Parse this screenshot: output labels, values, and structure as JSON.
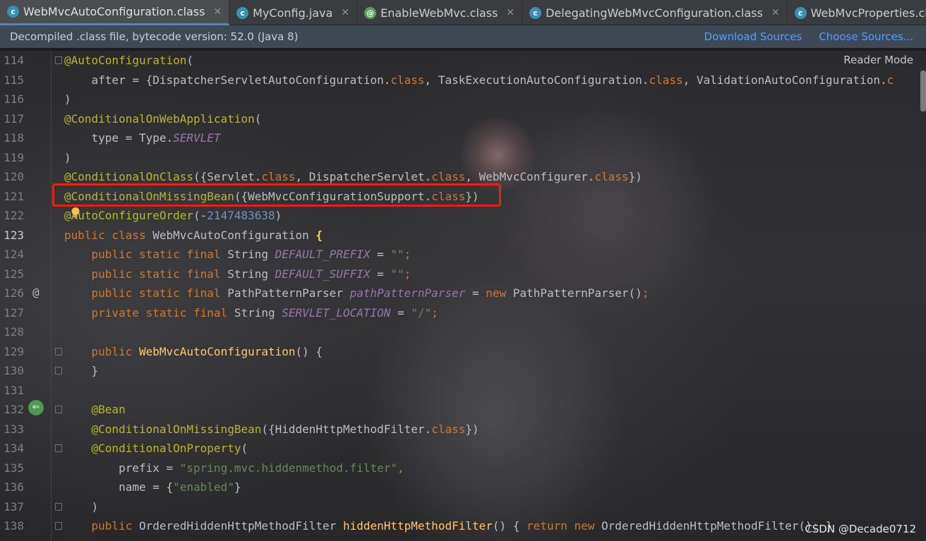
{
  "tabs": [
    {
      "label": "WebMvcAutoConfiguration.class",
      "icon": "class-file-icon",
      "active": true
    },
    {
      "label": "MyConfig.java",
      "icon": "class-file-icon",
      "active": false
    },
    {
      "label": "EnableWebMvc.class",
      "icon": "annotation-file-icon",
      "active": false
    },
    {
      "label": "DelegatingWebMvcConfiguration.class",
      "icon": "class-file-icon",
      "active": false
    },
    {
      "label": "WebMvcProperties.class",
      "icon": "class-file-icon",
      "active": false
    }
  ],
  "banner": {
    "message": "Decompiled .class file, bytecode version: 52.0 (Java 8)",
    "download_sources": "Download Sources",
    "choose_sources": "Choose Sources..."
  },
  "reader_mode": "Reader Mode",
  "current_line": 123,
  "lines": [
    {
      "n": "114",
      "fold": true,
      "tokens": [
        [
          "an",
          "@AutoConfiguration"
        ],
        [
          "p",
          "("
        ]
      ]
    },
    {
      "n": "115",
      "tokens": [
        [
          "p",
          "    after = {DispatcherServletAutoConfiguration."
        ],
        [
          "k",
          "class"
        ],
        [
          "p",
          ", "
        ],
        [
          "p",
          "TaskExecutionAutoConfiguration."
        ],
        [
          "k",
          "class"
        ],
        [
          "p",
          ", "
        ],
        [
          "p",
          "ValidationAutoConfiguration."
        ],
        [
          "k",
          "c"
        ]
      ]
    },
    {
      "n": "116",
      "tokens": [
        [
          "p",
          ")"
        ]
      ]
    },
    {
      "n": "117",
      "tokens": [
        [
          "an",
          "@ConditionalOnWebApplication"
        ],
        [
          "p",
          "("
        ]
      ]
    },
    {
      "n": "118",
      "tokens": [
        [
          "p",
          "    type = Type."
        ],
        [
          "sf",
          "SERVLET"
        ]
      ]
    },
    {
      "n": "119",
      "tokens": [
        [
          "p",
          ")"
        ]
      ]
    },
    {
      "n": "120",
      "tokens": [
        [
          "an",
          "@ConditionalOnClass"
        ],
        [
          "p",
          "({Servlet."
        ],
        [
          "k",
          "class"
        ],
        [
          "p",
          ", DispatcherServlet."
        ],
        [
          "k",
          "class"
        ],
        [
          "p",
          ", WebMvcConfigurer."
        ],
        [
          "k",
          "class"
        ],
        [
          "p",
          "})"
        ]
      ]
    },
    {
      "n": "121",
      "tokens": [
        [
          "an",
          "@ConditionalOnMissingBean"
        ],
        [
          "p",
          "({WebMvcConfigurationSupport."
        ],
        [
          "k",
          "class"
        ],
        [
          "p",
          "})"
        ]
      ]
    },
    {
      "n": "122",
      "tokens": [
        [
          "an",
          "@AutoConfigureOrder"
        ],
        [
          "p",
          "(-"
        ],
        [
          "nu",
          "2147483638"
        ],
        [
          "p",
          ")"
        ]
      ]
    },
    {
      "n": "123",
      "tokens": [
        [
          "k",
          "public class "
        ],
        [
          "p",
          "WebMvcAutoConfiguration "
        ],
        [
          "br",
          "{"
        ]
      ]
    },
    {
      "n": "124",
      "tokens": [
        [
          "k",
          "    public static final "
        ],
        [
          "p",
          "String "
        ],
        [
          "sf",
          "DEFAULT_PREFIX"
        ],
        [
          "p",
          " = "
        ],
        [
          "st",
          "\"\""
        ],
        [
          "k",
          ";"
        ]
      ]
    },
    {
      "n": "125",
      "tokens": [
        [
          "k",
          "    public static final "
        ],
        [
          "p",
          "String "
        ],
        [
          "sf",
          "DEFAULT_SUFFIX"
        ],
        [
          "p",
          " = "
        ],
        [
          "st",
          "\"\""
        ],
        [
          "k",
          ";"
        ]
      ]
    },
    {
      "n": "126",
      "mark": "@",
      "tokens": [
        [
          "k",
          "    public static final "
        ],
        [
          "p",
          "PathPatternParser "
        ],
        [
          "sf",
          "pathPatternParser"
        ],
        [
          "p",
          " = "
        ],
        [
          "k",
          "new "
        ],
        [
          "p",
          "PathPatternParser()"
        ],
        [
          "k",
          ";"
        ]
      ]
    },
    {
      "n": "127",
      "tokens": [
        [
          "k",
          "    private static final "
        ],
        [
          "p",
          "String "
        ],
        [
          "sf",
          "SERVLET_LOCATION"
        ],
        [
          "p",
          " = "
        ],
        [
          "st",
          "\"/\""
        ],
        [
          "k",
          ";"
        ]
      ]
    },
    {
      "n": "128",
      "tokens": []
    },
    {
      "n": "129",
      "fold": true,
      "tokens": [
        [
          "k",
          "    public "
        ],
        [
          "fn",
          "WebMvcAutoConfiguration"
        ],
        [
          "p",
          "() {"
        ]
      ]
    },
    {
      "n": "130",
      "fold": true,
      "tokens": [
        [
          "p",
          "    }"
        ]
      ]
    },
    {
      "n": "131",
      "tokens": []
    },
    {
      "n": "132",
      "run": true,
      "fold": true,
      "tokens": [
        [
          "an",
          "    @Bean"
        ]
      ]
    },
    {
      "n": "133",
      "tokens": [
        [
          "an",
          "    @ConditionalOnMissingBean"
        ],
        [
          "p",
          "({HiddenHttpMethodFilter."
        ],
        [
          "k",
          "class"
        ],
        [
          "p",
          "})"
        ]
      ]
    },
    {
      "n": "134",
      "fold": true,
      "tokens": [
        [
          "an",
          "    @ConditionalOnProperty"
        ],
        [
          "p",
          "("
        ]
      ]
    },
    {
      "n": "135",
      "tokens": [
        [
          "p",
          "        prefix = "
        ],
        [
          "st",
          "\"spring.mvc.hiddenmethod.filter\""
        ],
        [
          "k",
          ","
        ]
      ]
    },
    {
      "n": "136",
      "tokens": [
        [
          "p",
          "        name = {"
        ],
        [
          "st",
          "\"enabled\""
        ],
        [
          "p",
          "}"
        ]
      ]
    },
    {
      "n": "137",
      "fold": true,
      "tokens": [
        [
          "p",
          "    )"
        ]
      ]
    },
    {
      "n": "138",
      "fold": true,
      "tokens": [
        [
          "k",
          "    public "
        ],
        [
          "p",
          "OrderedHiddenHttpMethodFilter "
        ],
        [
          "fn",
          "hiddenHttpMethodFilter"
        ],
        [
          "p",
          "() { "
        ],
        [
          "k",
          "return new "
        ],
        [
          "p",
          "OrderedHiddenHttpMethodFilter()"
        ],
        [
          "k",
          "; "
        ],
        [
          "p",
          "}"
        ]
      ]
    }
  ],
  "watermark": "CSDN @Decade0712",
  "colors": {
    "highlight_box": "#e2231a",
    "accent": "#589df6"
  }
}
